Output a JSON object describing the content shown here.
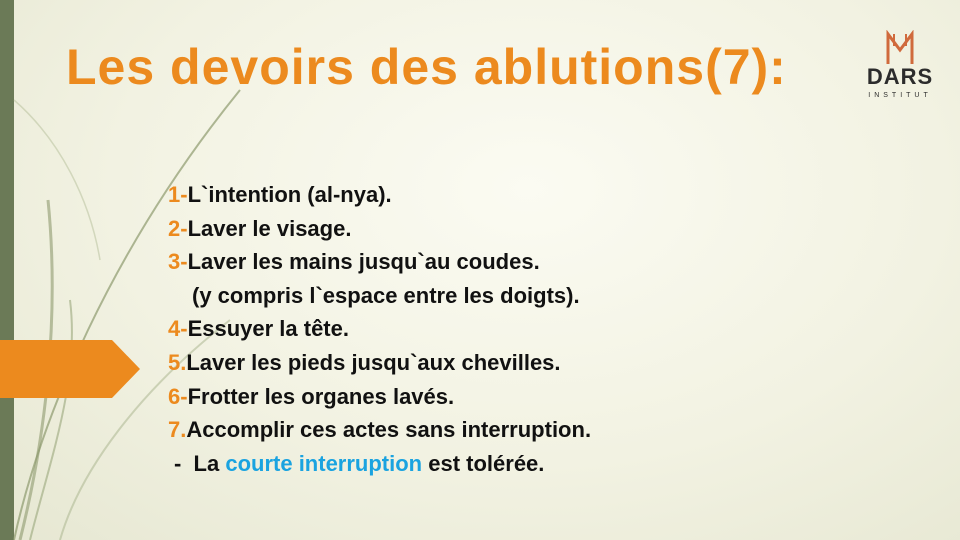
{
  "slide": {
    "title": "Les devoirs des ablutions(7):",
    "logo": {
      "name": "DARS",
      "sub": "INSTITUT"
    },
    "items": [
      {
        "num": "1-",
        "text": "L`intention (al-nya)."
      },
      {
        "num": "2-",
        "text": "Laver le visage."
      },
      {
        "num": "3-",
        "text": "Laver les mains jusqu`au coudes."
      },
      {
        "num": "",
        "text": "(y compris l`espace entre les doigts)."
      },
      {
        "num": "4-",
        "text": "Essuyer la tête."
      },
      {
        "num": "5.",
        "text": "Laver les pieds jusqu`aux chevilles."
      },
      {
        "num": "6-",
        "text": "Frotter les organes lavés."
      },
      {
        "num": "7.",
        "text": "Accomplir ces actes sans interruption."
      }
    ],
    "note": {
      "prefix": "-  La ",
      "highlight": "courte interruption",
      "suffix": " est tolérée."
    }
  },
  "colors": {
    "accent": "#ec8a1e",
    "highlight": "#1aa3e0",
    "bar": "#6b7a57"
  }
}
